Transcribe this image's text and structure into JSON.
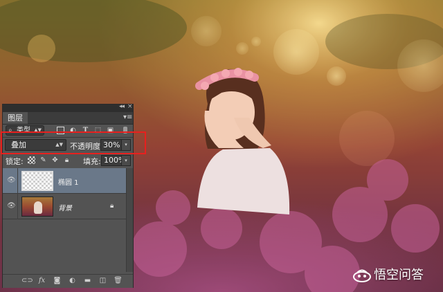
{
  "panel": {
    "tab_label": "图层",
    "filter_label": "类型",
    "blend_mode": "叠加",
    "opacity_label": "不透明度:",
    "opacity_value": "30%",
    "lock_label": "锁定:",
    "fill_label": "填充:",
    "fill_value": "100%",
    "layers": [
      {
        "name": "椭圆 1",
        "selected": true,
        "thumb": "transparent"
      },
      {
        "name": "背景",
        "selected": false,
        "thumb": "photo",
        "locked": true
      }
    ],
    "bottom_icons": [
      "link-icon",
      "fx-icon",
      "mask-icon",
      "adjustment-icon",
      "group-folder-icon",
      "new-layer-icon",
      "trash-icon"
    ],
    "filter_icons": [
      "pixel-filter-icon",
      "adjustment-filter-icon",
      "type-filter-icon",
      "shape-filter-icon",
      "smart-object-filter-icon"
    ]
  },
  "watermark": {
    "text": "悟空问答"
  },
  "colors": {
    "highlight": "#e8201e",
    "panel_bg": "#535353",
    "selected_layer": "#6a7889"
  }
}
